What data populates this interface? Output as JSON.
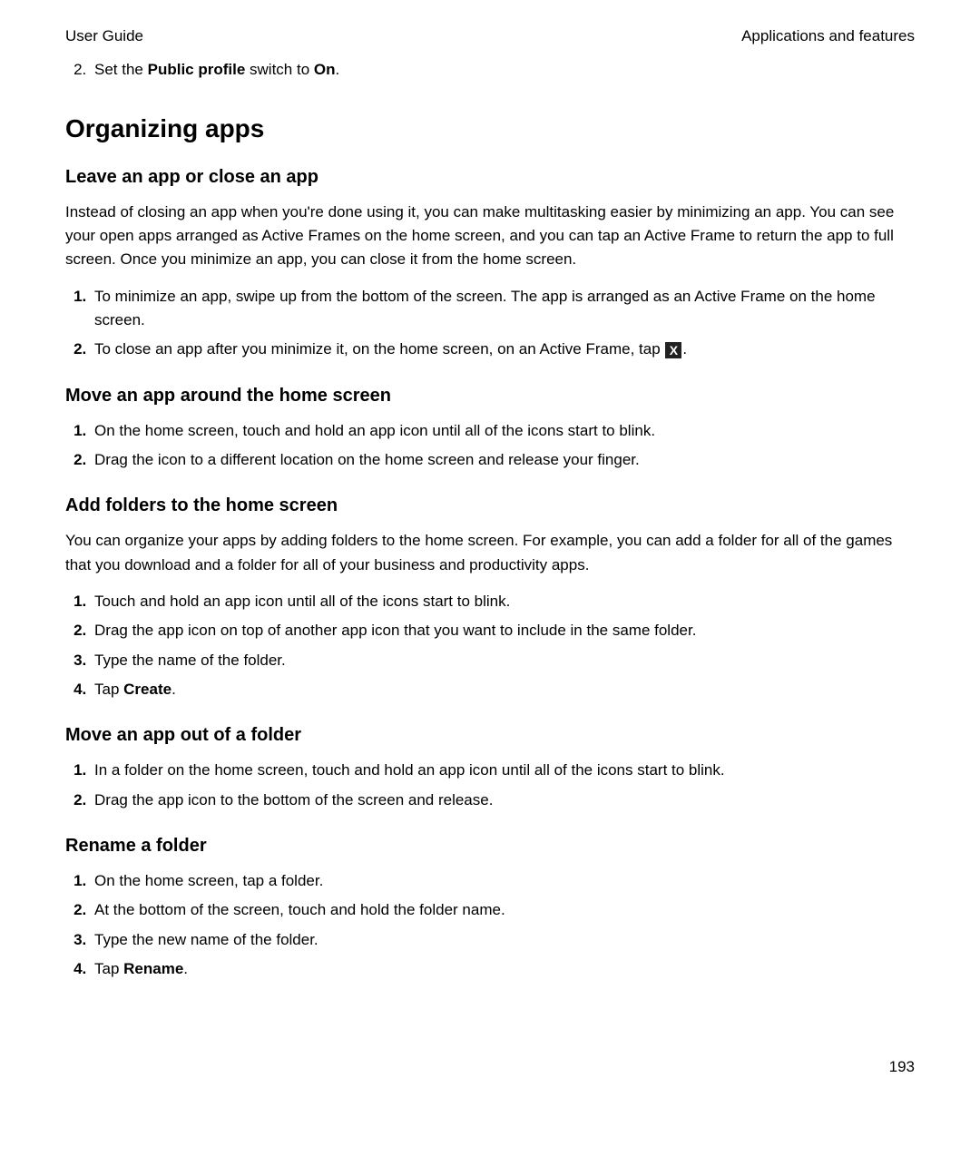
{
  "header": {
    "left": "User Guide",
    "right": "Applications and features"
  },
  "intro": {
    "num": "2.",
    "pre": "Set the ",
    "bold1": "Public profile",
    "mid": " switch to ",
    "bold2": "On",
    "post": "."
  },
  "h1": "Organizing apps",
  "sec1": {
    "heading": "Leave an app or close an app",
    "para": "Instead of closing an app when you're done using it, you can make multitasking easier by minimizing an app. You can see your open apps arranged as Active Frames on the home screen, and you can tap an Active Frame to return the app to full screen. Once you minimize an app, you can close it from the home screen.",
    "step1": "To minimize an app, swipe up from the bottom of the screen. The app is arranged as an Active Frame on the home screen.",
    "step2_pre": "To close an app after you minimize it, on the home screen, on an Active Frame, tap ",
    "step2_post": "."
  },
  "sec2": {
    "heading": "Move an app around the home screen",
    "step1": "On the home screen, touch and hold an app icon until all of the icons start to blink.",
    "step2": "Drag the icon to a different location on the home screen and release your finger."
  },
  "sec3": {
    "heading": "Add folders to the home screen",
    "para": "You can organize your apps by adding folders to the home screen. For example, you can add a folder for all of the games that you download and a folder for all of your business and productivity apps.",
    "step1": "Touch and hold an app icon until all of the icons start to blink.",
    "step2": "Drag the app icon on top of another app icon that you want to include in the same folder.",
    "step3": "Type the name of the folder.",
    "step4_pre": "Tap ",
    "step4_bold": "Create",
    "step4_post": "."
  },
  "sec4": {
    "heading": "Move an app out of a folder",
    "step1": "In a folder on the home screen, touch and hold an app icon until all of the icons start to blink.",
    "step2": "Drag the app icon to the bottom of the screen and release."
  },
  "sec5": {
    "heading": "Rename a folder",
    "step1": "On the home screen, tap a folder.",
    "step2": "At the bottom of the screen, touch and hold the folder name.",
    "step3": "Type the new name of the folder.",
    "step4_pre": "Tap ",
    "step4_bold": "Rename",
    "step4_post": "."
  },
  "pageNumber": "193",
  "closeGlyph": "X"
}
